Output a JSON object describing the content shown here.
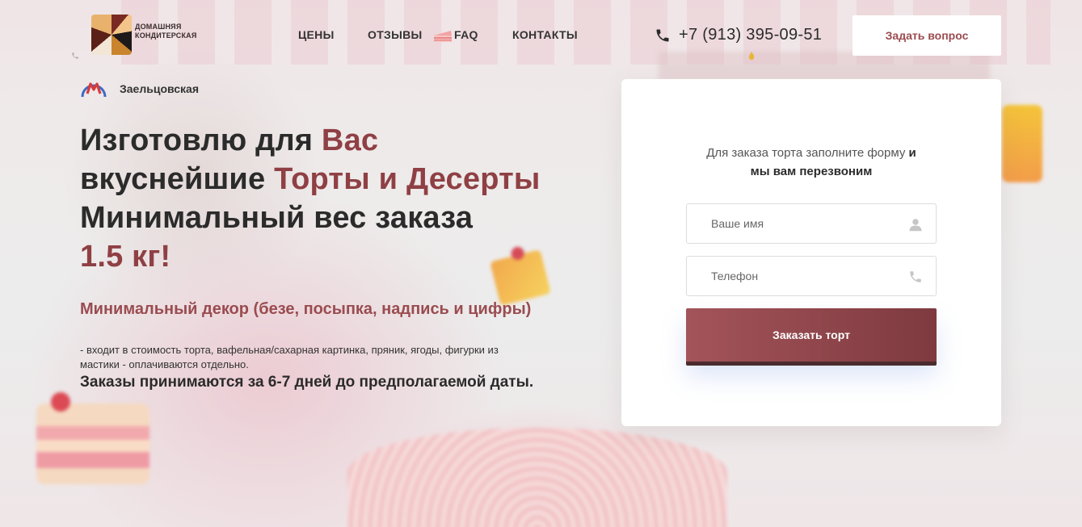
{
  "header": {
    "logo_text_line1": "ДОМАШНЯЯ",
    "logo_text_line2": "КОНДИТЕРСКАЯ",
    "nav": [
      {
        "label": "ЦЕНЫ"
      },
      {
        "label": "ОТЗЫВЫ"
      },
      {
        "label": "FAQ"
      },
      {
        "label": "КОНТАКТЫ"
      }
    ],
    "phone": "+7 (913) 395-09-51",
    "ask_button": "Задать вопрос"
  },
  "hero": {
    "metro_station": "Заельцовская",
    "headline": {
      "part1": "Изготовлю для ",
      "accent1": "Вас",
      "part2": "вкуснейшие ",
      "accent2": "Торты и Десерты",
      "part3": "Минимальный вес заказа",
      "accent3": "1.5 кг!"
    },
    "decor_title": "Минимальный декор (безе, посыпка, надпись и цифры)",
    "decor_note": "- входит в стоимость торта, вафельная/сахарная картинка, пряник, ягоды, фигурки из мастики - оплачиваются отдельно.",
    "deadline": "Заказы принимаются за 6-7 дней до предполагаемой даты."
  },
  "form": {
    "title_light": "Для заказа торта заполните форму",
    "title_bold1": "и",
    "title_bold2": "мы вам перезвоним",
    "name_placeholder": "Ваше имя",
    "phone_placeholder": "Телефон",
    "submit_label": "Заказать торт"
  },
  "icons": {
    "phone": "phone-icon",
    "metro": "metro-icon",
    "user": "user-icon",
    "phone_field": "phone-field-icon"
  },
  "colors": {
    "accent": "#8f4044",
    "button": "#9a4c50",
    "text": "#2b2b2b"
  }
}
